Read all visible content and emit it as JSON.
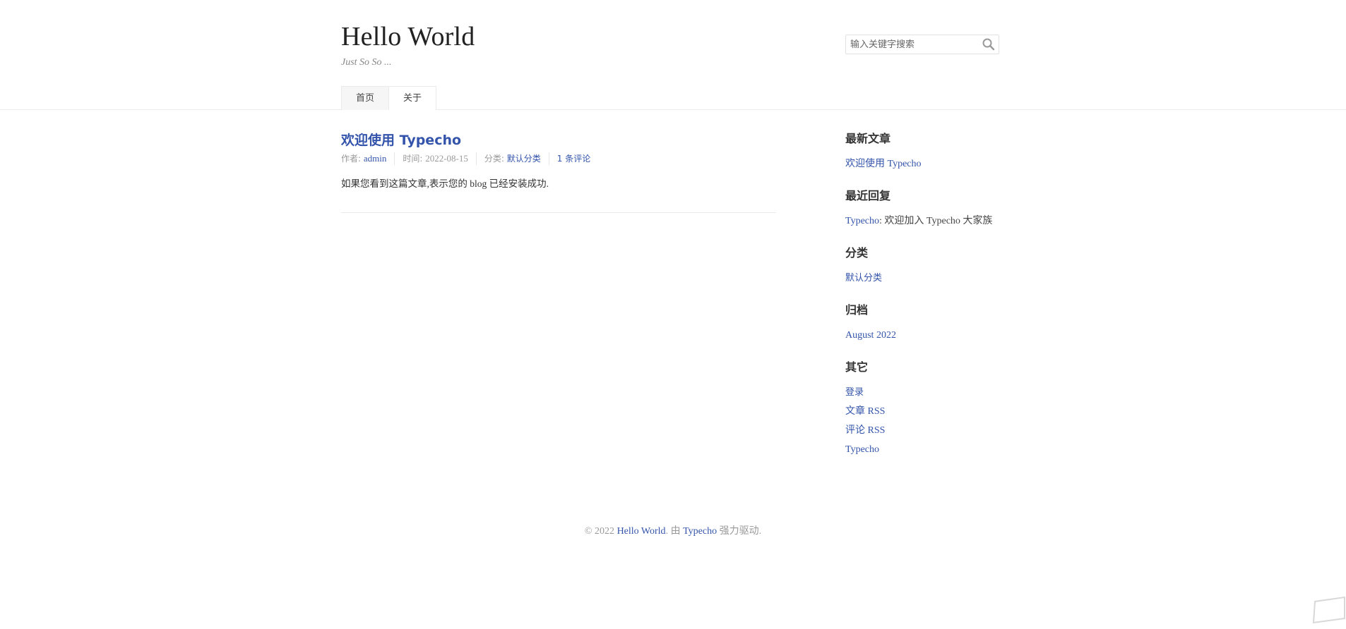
{
  "site": {
    "title": "Hello World",
    "tagline": "Just So So ..."
  },
  "search": {
    "placeholder": "输入关键字搜索",
    "icon": "search-icon"
  },
  "nav": {
    "tabs": [
      {
        "label": "首页",
        "active": true
      },
      {
        "label": "关于",
        "active": false
      }
    ]
  },
  "post": {
    "title": "欢迎使用 Typecho",
    "author_label": "作者: ",
    "author": "admin",
    "date_label": "时间: ",
    "date": "2022-08-15",
    "category_label": "分类: ",
    "category": "默认分类",
    "comments": "1 条评论",
    "excerpt": "如果您看到这篇文章,表示您的 blog 已经安装成功."
  },
  "sidebar": {
    "recent_posts": {
      "title": "最新文章",
      "items": [
        "欢迎使用 Typecho"
      ]
    },
    "recent_comments": {
      "title": "最近回复",
      "author": "Typecho",
      "text": ": 欢迎加入 Typecho 大家族"
    },
    "categories": {
      "title": "分类",
      "items": [
        "默认分类"
      ]
    },
    "archives": {
      "title": "归档",
      "items": [
        "August 2022"
      ]
    },
    "misc": {
      "title": "其它",
      "items": [
        "登录",
        "文章 RSS",
        "评论 RSS",
        "Typecho"
      ]
    }
  },
  "footer": {
    "prefix": "© 2022 ",
    "site_link": "Hello World",
    "middle": ". 由 ",
    "powered_link": "Typecho",
    "suffix": " 强力驱动."
  },
  "colors": {
    "link": "#3354aa",
    "text": "#444444",
    "muted": "#999999"
  }
}
